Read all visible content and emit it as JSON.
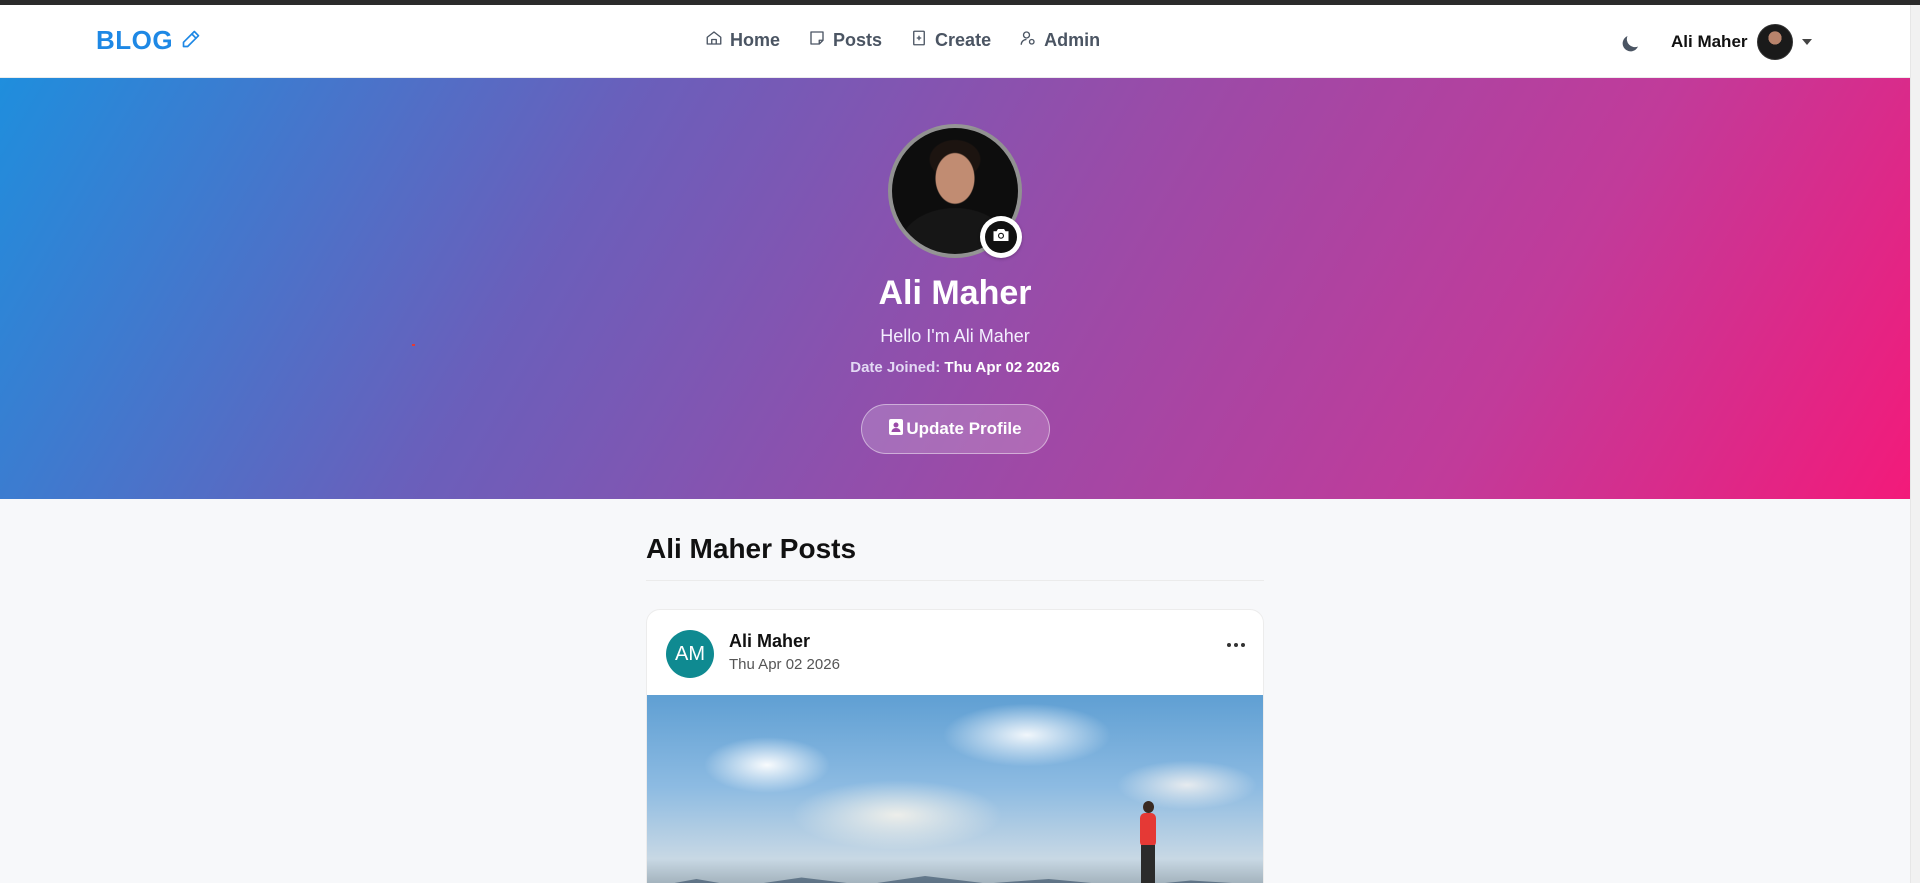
{
  "brand": {
    "label": "BLOG",
    "icon": "pencil-icon",
    "color": "#1e88e5"
  },
  "nav": {
    "items": [
      {
        "label": "Home",
        "icon": "home-icon"
      },
      {
        "label": "Posts",
        "icon": "posts-icon"
      },
      {
        "label": "Create",
        "icon": "create-icon"
      },
      {
        "label": "Admin",
        "icon": "admin-icon"
      }
    ]
  },
  "user_menu": {
    "name": "Ali Maher",
    "theme_icon": "moon-icon"
  },
  "profile": {
    "name": "Ali Maher",
    "bio": "Hello I'm Ali Maher",
    "joined_label": "Date Joined:",
    "joined_value": "Thu Apr 02 2026",
    "update_button": "Update Profile",
    "camera_icon": "camera-icon"
  },
  "posts_section": {
    "title": "Ali Maher Posts",
    "posts": [
      {
        "author_initials": "AM",
        "author": "Ali Maher",
        "date": "Thu Apr 02 2026"
      }
    ]
  },
  "colors": {
    "hero_gradient_start": "#1f8edd",
    "hero_gradient_end": "#f31a7a",
    "avatar_bg": "#0f8a91"
  }
}
